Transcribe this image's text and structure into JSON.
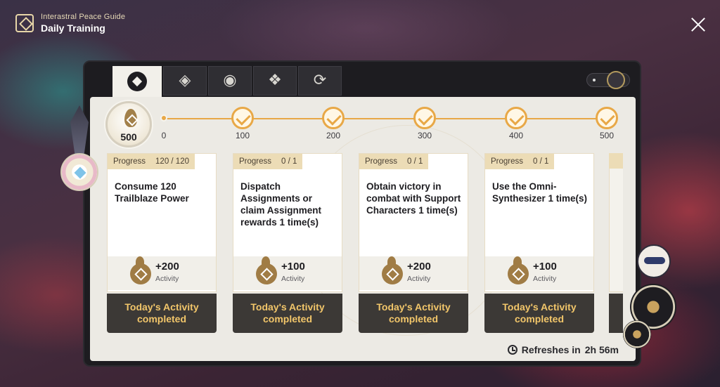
{
  "header": {
    "subtitle": "Interastral Peace Guide",
    "title": "Daily Training"
  },
  "tabs": [
    {
      "icon": "daily-training-icon",
      "active": true
    },
    {
      "icon": "survival-guide-icon",
      "active": false
    },
    {
      "icon": "treasures-lightward-icon",
      "active": false
    },
    {
      "icon": "strategic-training-icon",
      "active": false
    },
    {
      "icon": "echo-of-war-icon",
      "active": false
    }
  ],
  "activity": {
    "current": "500",
    "milestones": [
      {
        "label": "0",
        "completed": false
      },
      {
        "label": "100",
        "completed": true
      },
      {
        "label": "200",
        "completed": true
      },
      {
        "label": "300",
        "completed": true
      },
      {
        "label": "400",
        "completed": true
      },
      {
        "label": "500",
        "completed": true
      }
    ]
  },
  "cards": [
    {
      "progress_label": "Progress",
      "progress_value": "120 / 120",
      "description": "Consume 120 Trailblaze Power",
      "reward": "+200",
      "reward_label": "Activity",
      "status": "Today's Activity\ncompleted"
    },
    {
      "progress_label": "Progress",
      "progress_value": "0 / 1",
      "description": "Dispatch Assignments or claim Assignment rewards 1 time(s)",
      "reward": "+100",
      "reward_label": "Activity",
      "status": "Today's Activity\ncompleted"
    },
    {
      "progress_label": "Progress",
      "progress_value": "0 / 1",
      "description": "Obtain victory in combat with Support Characters 1 time(s)",
      "reward": "+200",
      "reward_label": "Activity",
      "status": "Today's Activity\ncompleted"
    },
    {
      "progress_label": "Progress",
      "progress_value": "0 / 1",
      "description": "Use the Omni-Synthesizer 1 time(s)",
      "reward": "+100",
      "reward_label": "Activity",
      "status": "Today's Activity\ncompleted"
    }
  ],
  "refresh": {
    "label": "Refreshes in",
    "time": "2h 56m"
  },
  "colors": {
    "accent": "#e8a847",
    "completed_text": "#f2c66a",
    "card_footer": "#3c3936",
    "progress_bg": "#ecdcb6"
  }
}
